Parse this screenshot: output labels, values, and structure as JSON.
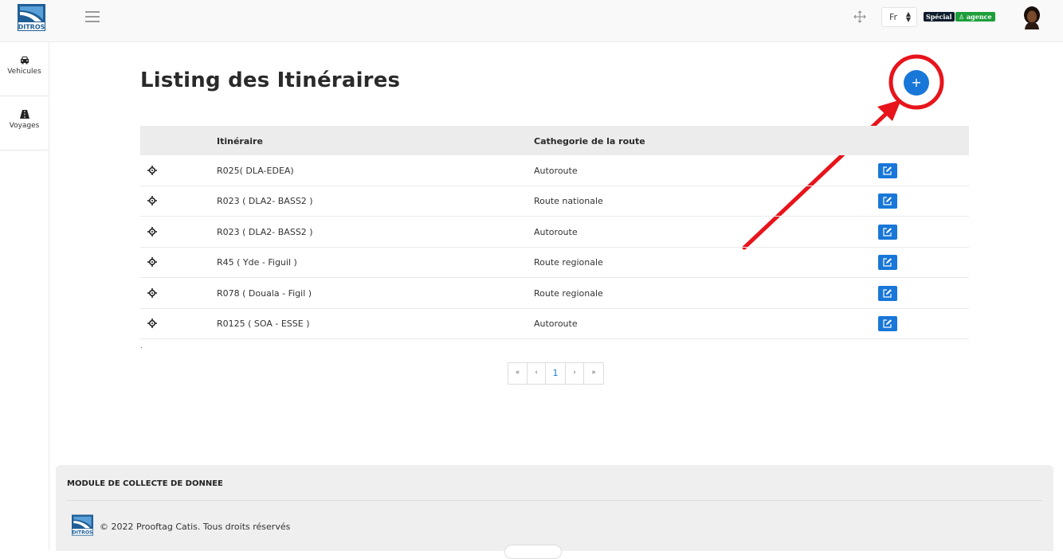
{
  "header": {
    "language": "Fr",
    "badge_special": "Spécial",
    "badge_agence": "agence",
    "logo_text": "DITROS"
  },
  "sidebar": {
    "items": [
      {
        "label": "Vehicules",
        "icon": "car-icon"
      },
      {
        "label": "Voyages",
        "icon": "road-icon"
      }
    ]
  },
  "main": {
    "title": "Listing des Itinéraires",
    "add_button": "+",
    "columns": [
      "Itinéraire",
      "Cathegorie de la route"
    ],
    "rows": [
      {
        "itineraire": "R025( DLA-EDEA)",
        "categorie": "Autoroute"
      },
      {
        "itineraire": "R023 ( DLA2- BASS2 )",
        "categorie": "Route nationale"
      },
      {
        "itineraire": "R023 ( DLA2- BASS2 )",
        "categorie": "Autoroute"
      },
      {
        "itineraire": "R45 ( Yde - Figuil )",
        "categorie": "Route regionale"
      },
      {
        "itineraire": "R078 ( Douala - Figil )",
        "categorie": "Route regionale"
      },
      {
        "itineraire": "R0125 ( SOA - ESSE )",
        "categorie": "Autoroute"
      }
    ],
    "trailing_dot": "."
  },
  "pagination": {
    "first": "«",
    "prev": "‹",
    "current": "1",
    "next": "›",
    "last": "»"
  },
  "footer": {
    "title": "MODULE DE COLLECTE DE DONNEE",
    "copyright": "© 2022 Prooftag Catis. Tous droits réservés"
  },
  "colors": {
    "primary": "#1877d8",
    "annotation": "#e8141b",
    "badge_special": "#0d1b2a",
    "badge_agence": "#1e9e3a"
  }
}
